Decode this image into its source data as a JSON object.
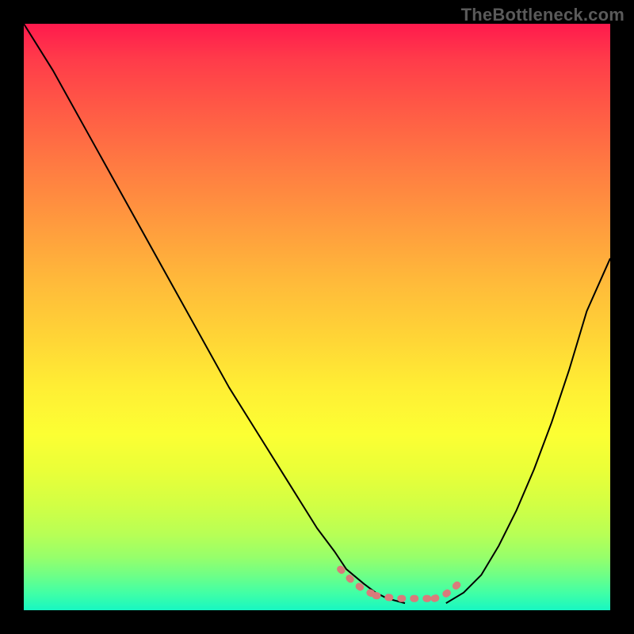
{
  "watermark": "TheBottleneck.com",
  "chart_data": {
    "type": "line",
    "title": "",
    "xlabel": "",
    "ylabel": "",
    "xlim": [
      0,
      100
    ],
    "ylim": [
      0,
      100
    ],
    "grid": false,
    "legend": false,
    "series": [
      {
        "name": "black-curve-left",
        "color": "#000000",
        "x": [
          0,
          5,
          10,
          15,
          20,
          25,
          30,
          35,
          40,
          45,
          50,
          53,
          55,
          58,
          60,
          62,
          65
        ],
        "y": [
          100,
          92,
          83,
          74,
          65,
          56,
          47,
          38,
          30,
          22,
          14,
          10,
          7,
          4.5,
          3,
          2,
          1.2
        ]
      },
      {
        "name": "black-curve-right",
        "color": "#000000",
        "x": [
          72,
          75,
          78,
          81,
          84,
          87,
          90,
          93,
          96,
          100
        ],
        "y": [
          1.2,
          3,
          6,
          11,
          17,
          24,
          32,
          41,
          51,
          60
        ]
      },
      {
        "name": "pink-left-end",
        "color": "#d97b7b",
        "x": [
          54,
          55,
          56,
          57,
          58,
          59,
          60
        ],
        "y": [
          7,
          6,
          5,
          4.2,
          3.5,
          3,
          2.6
        ]
      },
      {
        "name": "pink-bottom",
        "color": "#d97b7b",
        "x": [
          60,
          62,
          64,
          66,
          68,
          70
        ],
        "y": [
          2.5,
          2.2,
          2,
          2,
          2,
          2
        ]
      },
      {
        "name": "pink-right-end",
        "color": "#d97b7b",
        "x": [
          70,
          71,
          72,
          73,
          74,
          75
        ],
        "y": [
          2,
          2.3,
          2.8,
          3.5,
          4.4,
          5.5
        ]
      }
    ],
    "gradient_stops": [
      {
        "pos": 0,
        "hex": "#ff1a4d"
      },
      {
        "pos": 0.14,
        "hex": "#ff5846"
      },
      {
        "pos": 0.34,
        "hex": "#ff9a3e"
      },
      {
        "pos": 0.54,
        "hex": "#ffd636"
      },
      {
        "pos": 0.7,
        "hex": "#fcff33"
      },
      {
        "pos": 0.87,
        "hex": "#b8ff55"
      },
      {
        "pos": 1.0,
        "hex": "#17f7c2"
      }
    ]
  }
}
